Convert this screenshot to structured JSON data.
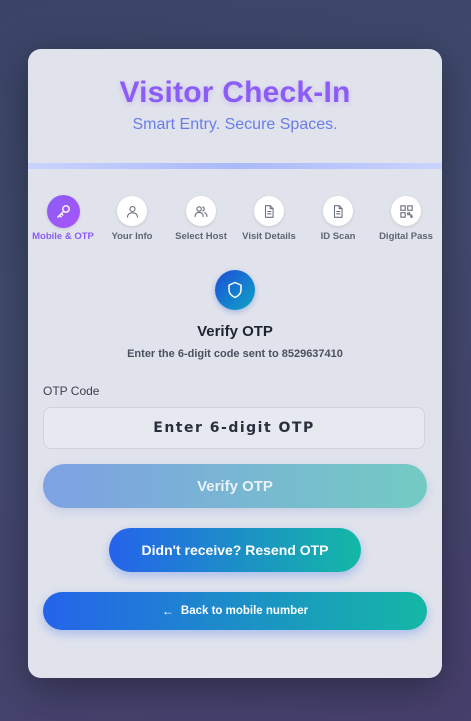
{
  "header": {
    "title": "Visitor Check-In",
    "subtitle": "Smart Entry. Secure Spaces."
  },
  "steps": [
    {
      "label": "Mobile & OTP",
      "icon": "key-icon",
      "active": true
    },
    {
      "label": "Your Info",
      "icon": "user-icon",
      "active": false
    },
    {
      "label": "Select Host",
      "icon": "users-icon",
      "active": false
    },
    {
      "label": "Visit Details",
      "icon": "document-icon",
      "active": false
    },
    {
      "label": "ID Scan",
      "icon": "document-icon",
      "active": false
    },
    {
      "label": "Digital Pass",
      "icon": "qr-code-icon",
      "active": false
    }
  ],
  "verify": {
    "icon": "shield-icon",
    "title": "Verify OTP",
    "subtitle": "Enter the 6-digit code sent to 8529637410"
  },
  "otp": {
    "label": "OTP Code",
    "value": "",
    "placeholder": "Enter 6-digit OTP"
  },
  "buttons": {
    "verify": "Verify OTP",
    "resend": "Didn't receive? Resend OTP",
    "back_arrow": "←",
    "back": "Back to mobile number"
  },
  "colors": {
    "accent": "#8b5cf6",
    "subtitle": "#6a7de8",
    "gradient_start": "#2563eb",
    "gradient_end": "#14b8a6"
  }
}
